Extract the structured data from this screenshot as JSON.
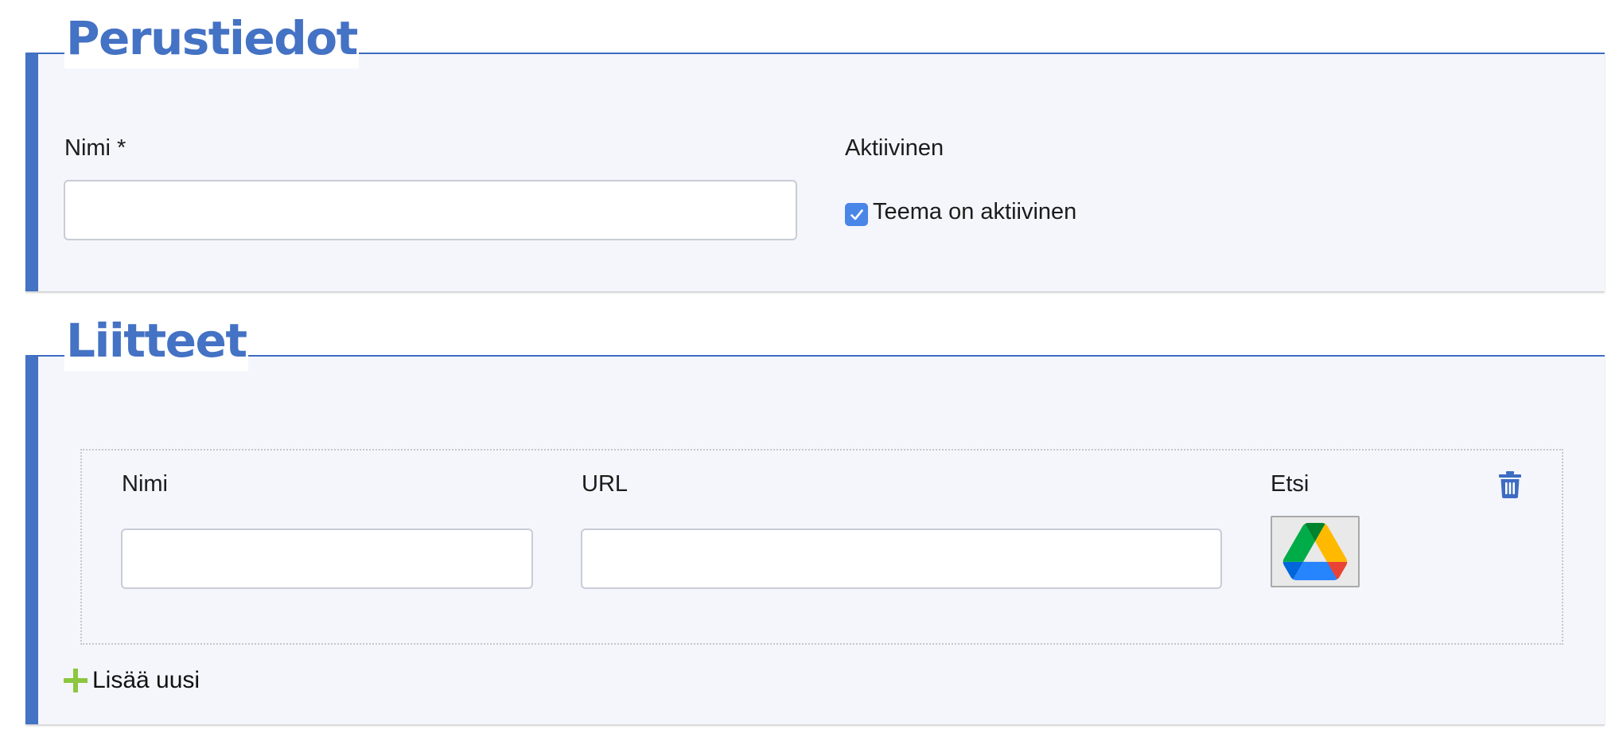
{
  "basic_info": {
    "legend": "Perustiedot",
    "name_label": "Nimi *",
    "name_value": "",
    "active_label": "Aktiivinen",
    "active_checkbox_label": "Teema on aktiivinen",
    "active_checked": true
  },
  "attachments": {
    "legend": "Liitteet",
    "name_label": "Nimi",
    "name_value": "",
    "url_label": "URL",
    "url_value": "",
    "search_label": "Etsi",
    "add_new_label": "Lisää uusi"
  },
  "icons": {
    "checkbox": "check-icon",
    "drive": "google-drive-icon",
    "delete": "trash-icon",
    "add": "plus-icon"
  },
  "colors": {
    "accent": "#4472c4",
    "checkbox": "#4a86e8",
    "add_plus": "#8dc63f",
    "panel_bg": "#f5f6fb",
    "drive_green": "#34a853",
    "drive_yellow": "#fbbc04",
    "drive_blue": "#4285f4"
  }
}
